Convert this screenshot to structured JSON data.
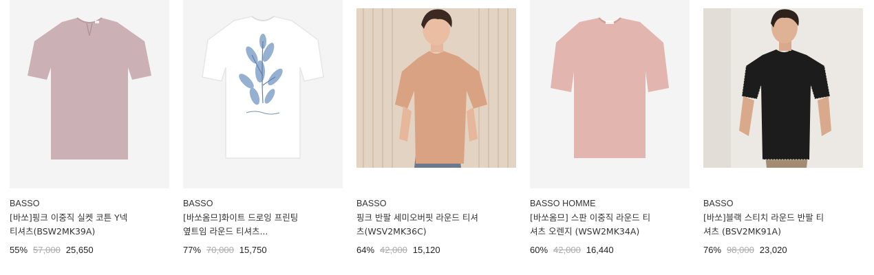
{
  "products": [
    {
      "brand": "BASSO",
      "name_line1": "[바쏘]핑크 이중직 실켓 코튼 Y넥",
      "name_line2": "티셔츠(BSW2MK39A)",
      "discount": "55%",
      "original_price": "57,000",
      "sale_price": "25,650",
      "icon": "pink-tshirt-image"
    },
    {
      "brand": "BASSO",
      "name_line1": "[바쏘옴므]화이트 드로잉 프린팅",
      "name_line2": "옆트임 라운드 티셔츠...",
      "discount": "77%",
      "original_price": "70,000",
      "sale_price": "15,750",
      "icon": "white-print-tshirt-image"
    },
    {
      "brand": "BASSO",
      "name_line1": "핑크 반팔 세미오버핏 라운드 티셔",
      "name_line2": "츠(WSV2MK36C)",
      "discount": "64%",
      "original_price": "42,000",
      "sale_price": "15,120",
      "icon": "model-peach-tshirt-photo"
    },
    {
      "brand": "BASSO HOMME",
      "name_line1": "[바쏘옴므] 스판 이중직 라운드 티",
      "name_line2": "셔츠 오렌지 (WSW2MK34A)",
      "discount": "60%",
      "original_price": "42,000",
      "sale_price": "16,440",
      "icon": "pink-round-tshirt-image"
    },
    {
      "brand": "BASSO",
      "name_line1": "[바쏘]블랙 스티치 라운드 반팔 티",
      "name_line2": "셔츠 (BSV2MK91A)",
      "discount": "76%",
      "original_price": "98,000",
      "sale_price": "23,020",
      "icon": "model-black-tshirt-photo"
    }
  ],
  "colors": {
    "card_bg": "#f5f4f4",
    "strike": "#aaaaaa",
    "text": "#333333"
  }
}
